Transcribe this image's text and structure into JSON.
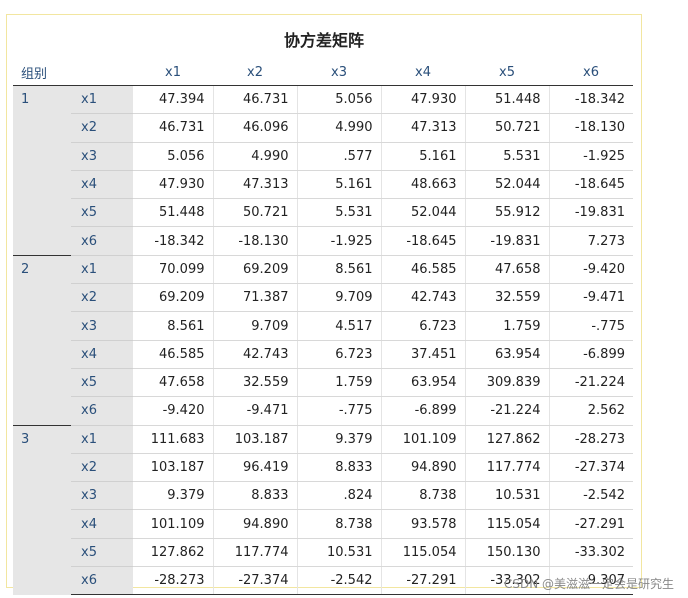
{
  "title": "协方差矩阵",
  "header": {
    "group_label": "组别",
    "columns": [
      "x1",
      "x2",
      "x3",
      "x4",
      "x5",
      "x6"
    ]
  },
  "groups": [
    {
      "label": "1",
      "rows": [
        {
          "var": "x1",
          "values": [
            "47.394",
            "46.731",
            "5.056",
            "47.930",
            "51.448",
            "-18.342"
          ]
        },
        {
          "var": "x2",
          "values": [
            "46.731",
            "46.096",
            "4.990",
            "47.313",
            "50.721",
            "-18.130"
          ]
        },
        {
          "var": "x3",
          "values": [
            "5.056",
            "4.990",
            ".577",
            "5.161",
            "5.531",
            "-1.925"
          ]
        },
        {
          "var": "x4",
          "values": [
            "47.930",
            "47.313",
            "5.161",
            "48.663",
            "52.044",
            "-18.645"
          ]
        },
        {
          "var": "x5",
          "values": [
            "51.448",
            "50.721",
            "5.531",
            "52.044",
            "55.912",
            "-19.831"
          ]
        },
        {
          "var": "x6",
          "values": [
            "-18.342",
            "-18.130",
            "-1.925",
            "-18.645",
            "-19.831",
            "7.273"
          ]
        }
      ]
    },
    {
      "label": "2",
      "rows": [
        {
          "var": "x1",
          "values": [
            "70.099",
            "69.209",
            "8.561",
            "46.585",
            "47.658",
            "-9.420"
          ]
        },
        {
          "var": "x2",
          "values": [
            "69.209",
            "71.387",
            "9.709",
            "42.743",
            "32.559",
            "-9.471"
          ]
        },
        {
          "var": "x3",
          "values": [
            "8.561",
            "9.709",
            "4.517",
            "6.723",
            "1.759",
            "-.775"
          ]
        },
        {
          "var": "x4",
          "values": [
            "46.585",
            "42.743",
            "6.723",
            "37.451",
            "63.954",
            "-6.899"
          ]
        },
        {
          "var": "x5",
          "values": [
            "47.658",
            "32.559",
            "1.759",
            "63.954",
            "309.839",
            "-21.224"
          ]
        },
        {
          "var": "x6",
          "values": [
            "-9.420",
            "-9.471",
            "-.775",
            "-6.899",
            "-21.224",
            "2.562"
          ]
        }
      ]
    },
    {
      "label": "3",
      "rows": [
        {
          "var": "x1",
          "values": [
            "111.683",
            "103.187",
            "9.379",
            "101.109",
            "127.862",
            "-28.273"
          ]
        },
        {
          "var": "x2",
          "values": [
            "103.187",
            "96.419",
            "8.833",
            "94.890",
            "117.774",
            "-27.374"
          ]
        },
        {
          "var": "x3",
          "values": [
            "9.379",
            "8.833",
            ".824",
            "8.738",
            "10.531",
            "-2.542"
          ]
        },
        {
          "var": "x4",
          "values": [
            "101.109",
            "94.890",
            "8.738",
            "93.578",
            "115.054",
            "-27.291"
          ]
        },
        {
          "var": "x5",
          "values": [
            "127.862",
            "117.774",
            "10.531",
            "115.054",
            "150.130",
            "-33.302"
          ]
        },
        {
          "var": "x6",
          "values": [
            "-28.273",
            "-27.374",
            "-2.542",
            "-27.291",
            "-33.302",
            "9.307"
          ]
        }
      ]
    }
  ],
  "watermark": "CSDN @美滋滋一定会是研究生"
}
